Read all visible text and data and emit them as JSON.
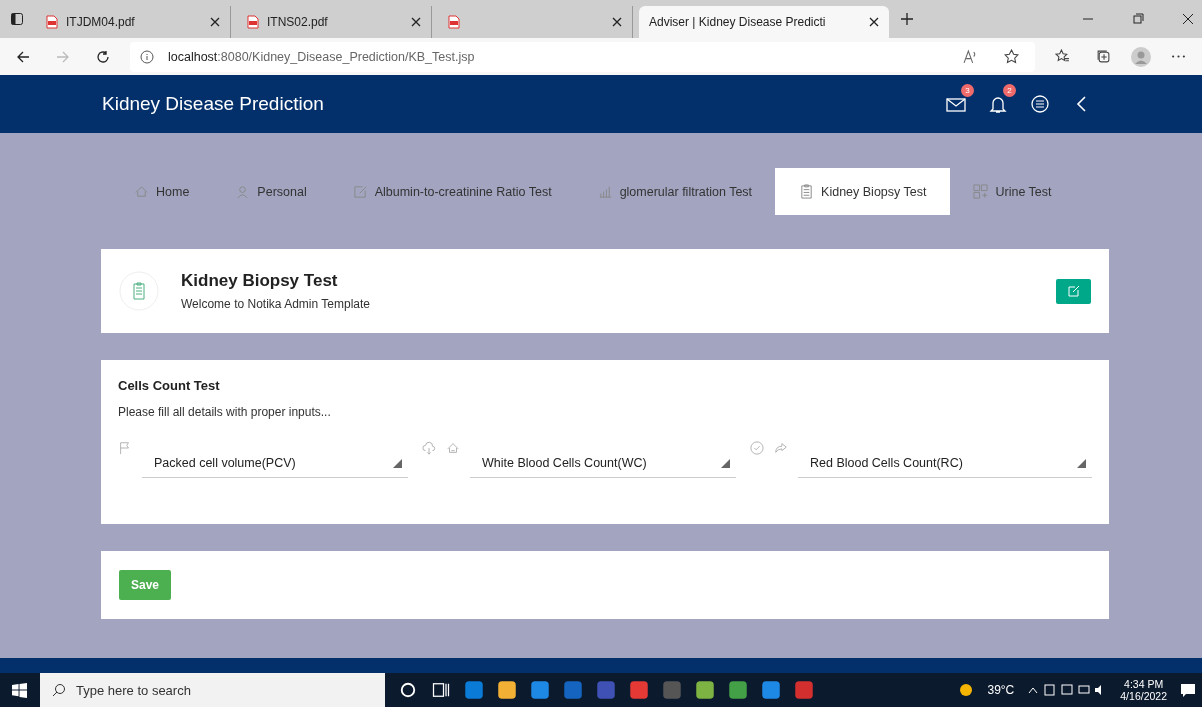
{
  "browser": {
    "tabs": [
      {
        "title": "ITJDM04.pdf",
        "kind": "pdf",
        "selected": false
      },
      {
        "title": "ITNS02.pdf",
        "kind": "pdf",
        "selected": false
      },
      {
        "kind": "pdf",
        "selected": false
      },
      {
        "title": "Adviser | Kidney Disease Predicti",
        "kind": "page",
        "selected": true
      }
    ],
    "url_host": "localhost",
    "url_rest": ":8080/Kidney_Disease_Prediction/KB_Test.jsp"
  },
  "header": {
    "title": "Kidney Disease Prediction",
    "mail_count": "3",
    "alert_count": "2"
  },
  "nav": [
    {
      "label": "Home",
      "selected": false
    },
    {
      "label": "Personal",
      "selected": false
    },
    {
      "label": "Albumin-to-creatinine Ratio Test",
      "selected": false
    },
    {
      "label": "glomerular filtration Test",
      "selected": false
    },
    {
      "label": "Kidney Biopsy Test",
      "selected": true
    },
    {
      "label": "Urine Test",
      "selected": false
    }
  ],
  "page_card": {
    "title": "Kidney Biopsy Test",
    "subtitle": "Welcome to Notika Admin Template"
  },
  "form": {
    "title": "Cells Count Test",
    "hint": "Please fill all details with proper inputs...",
    "fields": [
      {
        "value": "Packed cell volume(PCV)"
      },
      {
        "value": "White Blood Cells Count(WC)"
      },
      {
        "value": "Red Blood Cells Count(RC)"
      }
    ]
  },
  "save_label": "Save",
  "taskbar": {
    "search_placeholder": "Type here to search",
    "weather": "39°C",
    "time": "4:34 PM",
    "date": "4/16/2022"
  }
}
